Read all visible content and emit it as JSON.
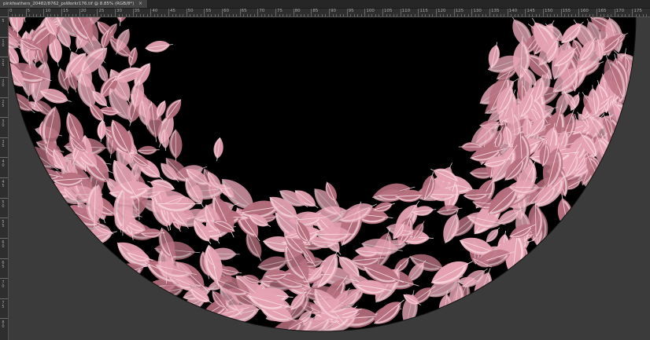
{
  "document": {
    "tab_title": "pinkfeathers_20482/8762_psWorkr176.tif @ 8.85% (RGB/8*)",
    "close_glyph": "×"
  },
  "rulers": {
    "horizontal_labels": [
      "0",
      "5",
      "10",
      "15",
      "20",
      "25",
      "30",
      "35",
      "40",
      "45",
      "50",
      "55",
      "60",
      "65",
      "70",
      "75",
      "80",
      "85",
      "90",
      "95",
      "100",
      "105",
      "110",
      "115",
      "120",
      "125",
      "130",
      "135",
      "140",
      "145",
      "150",
      "155",
      "160",
      "165",
      "170",
      "175"
    ],
    "vertical_labels": [
      "5",
      "10",
      "15",
      "20",
      "25",
      "30",
      "35",
      "40",
      "45",
      "50",
      "55",
      "60",
      "65",
      "70",
      "75",
      "80"
    ]
  },
  "artwork": {
    "background_color": "#000000",
    "feather_color": "#e6a3b4",
    "feather_shade": "#b8707f",
    "feather_highlight": "#fbe4ea",
    "canvas_outer_color": "#3b3b3b"
  }
}
